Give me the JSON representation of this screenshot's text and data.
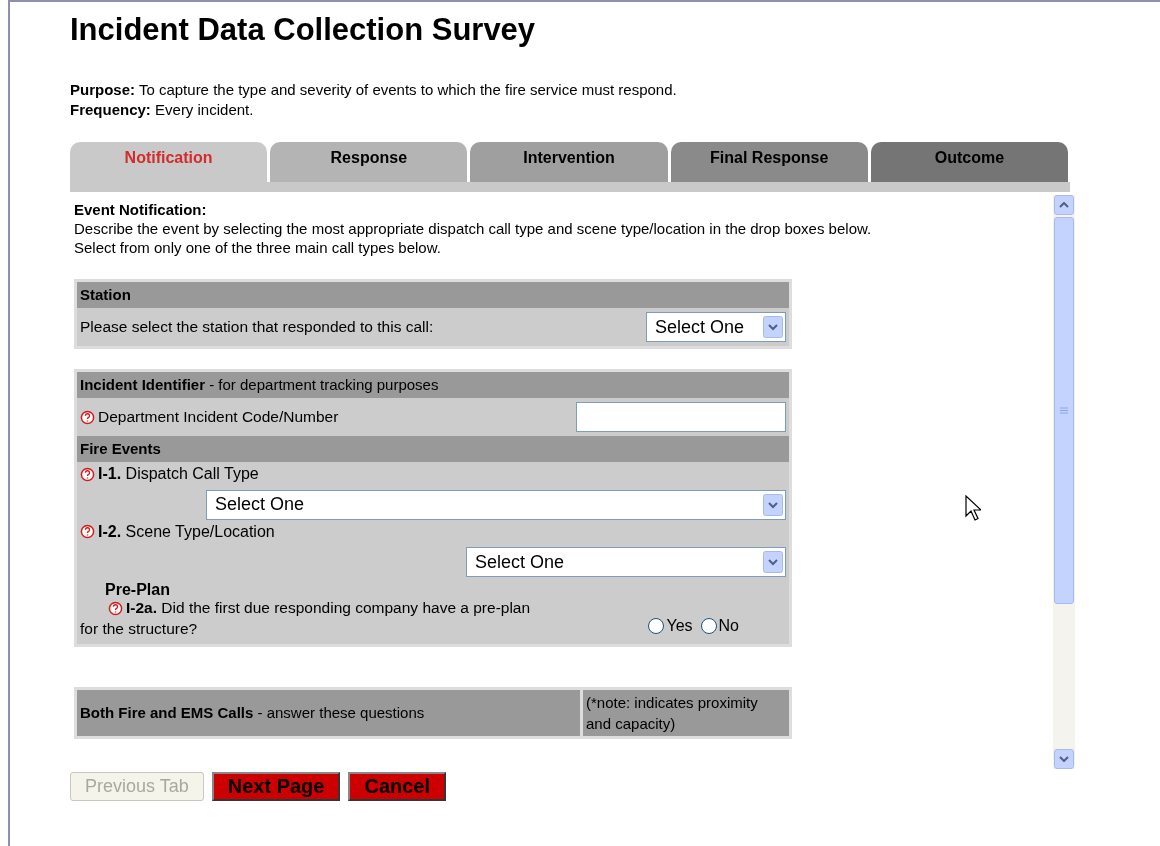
{
  "title": "Incident Data Collection Survey",
  "purpose": {
    "label": "Purpose:",
    "text": "To capture the type and severity of events to which the fire service must respond."
  },
  "frequency": {
    "label": "Frequency:",
    "text": "Every incident."
  },
  "tabs": [
    {
      "label": "Notification",
      "selected": true
    },
    {
      "label": "Response",
      "selected": false
    },
    {
      "label": "Intervention",
      "selected": false
    },
    {
      "label": "Final Response",
      "selected": false
    },
    {
      "label": "Outcome",
      "selected": false
    }
  ],
  "panel": {
    "heading": "Event Notification:",
    "description": [
      "Describe the event by selecting the most appropriate dispatch call type and scene type/location in the drop boxes below.",
      "Select from only one of the three main call types below."
    ],
    "station": {
      "header": "Station",
      "label": "Please select the station that responded to this call:",
      "value": "Select One"
    },
    "identifier": {
      "header": "**Incident Identifier** - for department tracking purposes",
      "label": "Department Incident Code/Number"
    },
    "fire_events": {
      "header": "Fire Events",
      "questions": [
        {
          "kind": "select",
          "label": "**I-1.** Dispatch Call Type",
          "value": "Select One"
        },
        {
          "kind": "select",
          "label": "**I-2.** Scene Type/Location",
          "value": "Select One"
        }
      ],
      "preplan": {
        "heading": "Pre-Plan",
        "question": "**I-2a.** Did the first due responding company have a pre-plan",
        "question_cont": "for the structure?",
        "options": [
          {
            "label": "Yes",
            "selected": false
          },
          {
            "label": "No",
            "selected": false
          }
        ]
      }
    },
    "both": {
      "header": "**Both Fire and EMS Calls** - answer these questions",
      "note": "(*note: indicates proximity and capacity)"
    }
  },
  "buttons": [
    {
      "label": "Previous Tab",
      "kind": "nav",
      "disabled": true
    },
    {
      "label": "Next Page",
      "kind": "action",
      "disabled": false
    },
    {
      "label": "Cancel",
      "kind": "action",
      "disabled": false
    }
  ]
}
